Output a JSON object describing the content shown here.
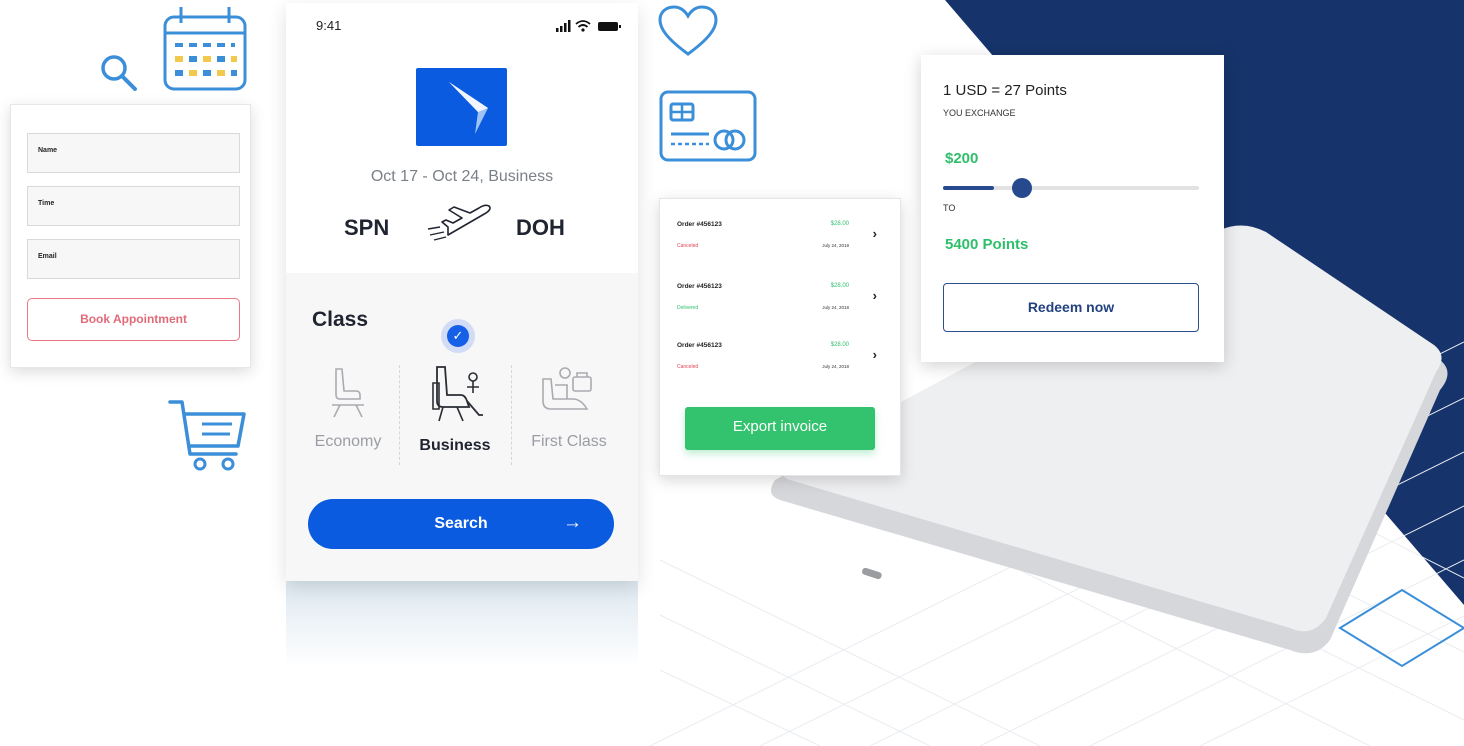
{
  "colors": {
    "navy": "#16346b",
    "primary_blue": "#0b5be0",
    "icon_blue": "#3b8fd9",
    "green": "#2fbf6a",
    "red": "#e53e4f",
    "pink": "#e06c7a"
  },
  "decor_icons": [
    "search-icon",
    "calendar-icon",
    "heart-icon",
    "credit-card-icon",
    "cart-icon",
    "diamond-outline"
  ],
  "appointment_form": {
    "fields": [
      {
        "label": "Name"
      },
      {
        "label": "Time"
      },
      {
        "label": "Email"
      }
    ],
    "submit_label": "Book Appointment"
  },
  "flight_app": {
    "status_time": "9:41",
    "trip_dates": "Oct 17 - Oct 24, Business",
    "from_code": "SPN",
    "to_code": "DOH",
    "class_heading": "Class",
    "classes": [
      {
        "label": "Economy",
        "selected": false
      },
      {
        "label": "Business",
        "selected": true
      },
      {
        "label": "First Class",
        "selected": false
      }
    ],
    "search_label": "Search",
    "search_arrow": "→"
  },
  "orders": {
    "rows": [
      {
        "number": "Order #456123",
        "amount": "$28.00",
        "status": "Canceled",
        "status_color": "#e53e4f",
        "date": "July 24, 2018"
      },
      {
        "number": "Order #456123",
        "amount": "$28.00",
        "status": "Delivered",
        "status_color": "#2fbf6a",
        "date": "July 24, 2018"
      },
      {
        "number": "Order #456123",
        "amount": "$28.00",
        "status": "Canceled",
        "status_color": "#e53e4f",
        "date": "July 24, 2018"
      }
    ],
    "export_label": "Export invoice"
  },
  "redeem": {
    "rate": "1 USD = 27 Points",
    "exchange_caption": "YOU EXCHANGE",
    "exchange_amount": "$200",
    "slider_fraction": 0.2,
    "to_caption": "TO",
    "points_result": "5400 Points",
    "redeem_label": "Redeem now"
  }
}
